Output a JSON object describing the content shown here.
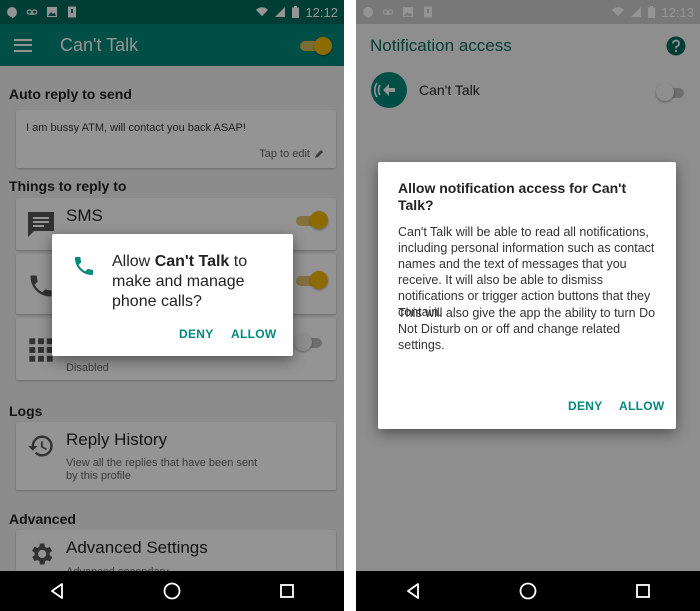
{
  "left": {
    "status_bar": {
      "time": "12:12"
    },
    "app_bar": {
      "title": "Can't Talk"
    },
    "sections": {
      "auto_reply": "Auto reply to send",
      "things": "Things to reply to",
      "logs": "Logs",
      "advanced": "Advanced"
    },
    "auto_reply": {
      "text": "I am bussy ATM, will contact you back ASAP!",
      "tap_to_edit": "Tap to edit"
    },
    "rows": {
      "sms": {
        "title": "SMS"
      },
      "third": {
        "subtitle": "Disabled"
      },
      "history": {
        "title": "Reply History",
        "subtitle_line1": "View all the replies that have been sent",
        "subtitle_line2": "by this profile"
      },
      "advanced": {
        "title": "Advanced Settings",
        "subtitle": "Advanced secondary"
      }
    },
    "dialog": {
      "prefix": "Allow ",
      "app_name": "Can't Talk",
      "suffix": " to make and manage phone calls?",
      "deny": "DENY",
      "allow": "ALLOW"
    }
  },
  "right": {
    "status_bar": {
      "time": "12:13"
    },
    "app_bar": {
      "title": "Notification access"
    },
    "app_row": {
      "name": "Can't Talk"
    },
    "dialog": {
      "title": "Allow notification access for Can't Talk?",
      "body1": "Can't Talk will be able to read all notifications, including personal information such as contact names and the text of messages that you receive. It will also be able to dismiss notifications or trigger action buttons that they contain.",
      "body2": "This will also give the app the ability to turn Do Not Disturb on or off and change related settings.",
      "deny": "DENY",
      "allow": "ALLOW"
    }
  },
  "colors": {
    "primary": "#00897b",
    "primary_dark": "#00695c",
    "accent": "#f5b800"
  },
  "icons": [
    "hangouts-icon",
    "voicemail-icon",
    "image-icon",
    "sim-icon",
    "wifi-icon",
    "signal-icon",
    "battery-icon",
    "menu-icon",
    "sms-icon",
    "phone-icon",
    "dialpad-icon",
    "history-icon",
    "settings-icon",
    "help-icon",
    "back-icon",
    "home-icon",
    "recents-icon"
  ]
}
